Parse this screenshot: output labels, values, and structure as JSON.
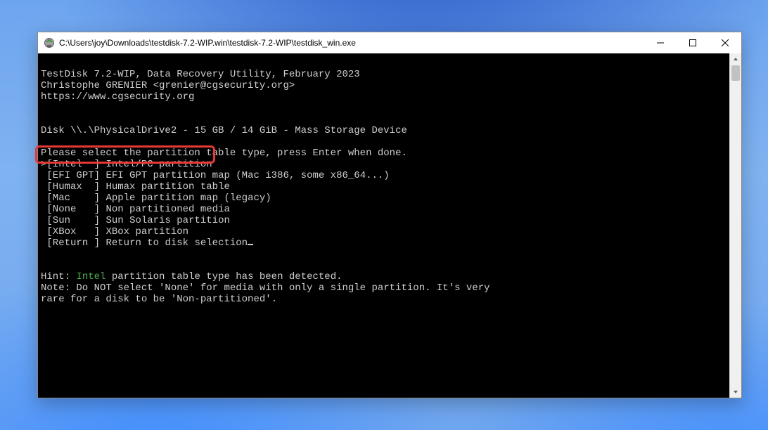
{
  "window": {
    "title": "C:\\Users\\joy\\Downloads\\testdisk-7.2-WIP.win\\testdisk-7.2-WIP\\testdisk_win.exe"
  },
  "terminal": {
    "header_line1": "TestDisk 7.2-WIP, Data Recovery Utility, February 2023",
    "header_line2": "Christophe GRENIER <grenier@cgsecurity.org>",
    "header_line3": "https://www.cgsecurity.org",
    "disk_line": "Disk \\\\.\\PhysicalDrive2 - 15 GB / 14 GiB - Mass Storage Device",
    "prompt": "Please select the partition table type, press Enter when done.",
    "options": [
      {
        "cursor": ">",
        "key": "[Intel  ]",
        "desc": "Intel/PC partition"
      },
      {
        "cursor": " ",
        "key": "[EFI GPT]",
        "desc": "EFI GPT partition map (Mac i386, some x86_64...)"
      },
      {
        "cursor": " ",
        "key": "[Humax  ]",
        "desc": "Humax partition table"
      },
      {
        "cursor": " ",
        "key": "[Mac    ]",
        "desc": "Apple partition map (legacy)"
      },
      {
        "cursor": " ",
        "key": "[None   ]",
        "desc": "Non partitioned media"
      },
      {
        "cursor": " ",
        "key": "[Sun    ]",
        "desc": "Sun Solaris partition"
      },
      {
        "cursor": " ",
        "key": "[XBox   ]",
        "desc": "XBox partition"
      },
      {
        "cursor": " ",
        "key": "[Return ]",
        "desc": "Return to disk selection"
      }
    ],
    "hint_prefix": "Hint: ",
    "hint_detected": "Intel",
    "hint_suffix": " partition table type has been detected.",
    "note_line1": "Note: Do NOT select 'None' for media with only a single partition. It's very",
    "note_line2": "rare for a disk to be 'Non-partitioned'."
  }
}
